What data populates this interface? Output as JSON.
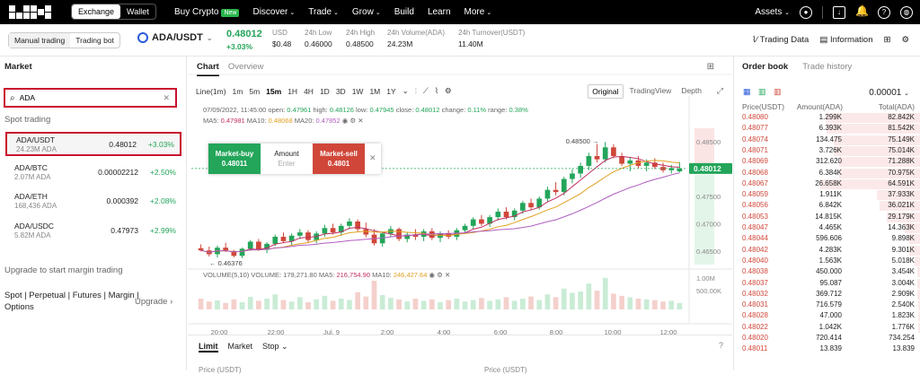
{
  "nav": {
    "exchange": "Exchange",
    "wallet": "Wallet",
    "items": [
      {
        "label": "Buy Crypto",
        "badge": "New"
      },
      {
        "label": "Discover",
        "chev": "⌄"
      },
      {
        "label": "Trade",
        "chev": "⌄"
      },
      {
        "label": "Grow",
        "chev": "⌄"
      },
      {
        "label": "Build",
        "chev": ""
      },
      {
        "label": "Learn",
        "chev": ""
      },
      {
        "label": "More",
        "chev": "⌄"
      }
    ],
    "assets": "Assets"
  },
  "ticker": {
    "mode_manual": "Manual trading",
    "mode_bot": "Trading bot",
    "pair": "ADA/USDT",
    "price": "0.48012",
    "change": "+3.03%",
    "stats": [
      {
        "label": "USD",
        "value": "$0.48"
      },
      {
        "label": "24h Low",
        "value": "0.46000"
      },
      {
        "label": "24h High",
        "value": "0.48500"
      },
      {
        "label": "24h Volume(ADA)",
        "value": "24.23M"
      },
      {
        "label": "24h Turnover(USDT)",
        "value": "11.40M"
      }
    ],
    "trading_data": "Trading Data",
    "information": "Information"
  },
  "market": {
    "title": "Market",
    "search_value": "ADA",
    "section": "Spot trading",
    "rows": [
      {
        "name": "ADA/USDT",
        "sub": "24.23M ADA",
        "price": "0.48012",
        "change": "+3.03%"
      },
      {
        "name": "ADA/BTC",
        "sub": "2.07M ADA",
        "price": "0.00002212",
        "change": "+2.50%"
      },
      {
        "name": "ADA/ETH",
        "sub": "168,436 ADA",
        "price": "0.000392",
        "change": "+2.08%"
      },
      {
        "name": "ADA/USDC",
        "sub": "5.82M ADA",
        "price": "0.47973",
        "change": "+2.99%"
      }
    ],
    "upgrade_text": "Upgrade to start margin trading",
    "types": "Spot | Perpetual | Futures | Margin | Options",
    "upgrade_btn": "Upgrade"
  },
  "chart": {
    "tab_chart": "Chart",
    "tab_overview": "Overview",
    "intervals": [
      "Line(1m)",
      "1m",
      "5m",
      "15m",
      "1H",
      "4H",
      "1D",
      "3D",
      "1W",
      "1M",
      "1Y"
    ],
    "active_interval": "15m",
    "views": [
      "Original",
      "TradingView",
      "Depth"
    ],
    "ohlc_date": "07/09/2022, 11:45:00",
    "ohlc_open": "0.47961",
    "ohlc_high": "0.48126",
    "ohlc_low": "0.47945",
    "ohlc_close": "0.48012",
    "ohlc_change": "0.11%",
    "ohlc_range": "0.38%",
    "ma5": "0.47981",
    "ma10": "0.48068",
    "ma20": "0.47852",
    "high_label": "0.48500",
    "low_label": "0.46376",
    "last_price": "0.48012",
    "y_ticks": [
      "0.48500",
      "0.47500",
      "0.47000",
      "0.46500"
    ],
    "x_ticks": [
      "20:00",
      "22:00",
      "Jul. 9",
      "2:00",
      "4:00",
      "6:00",
      "8:00",
      "10:00",
      "12:00"
    ],
    "vol_label": "VOLUME(5,10)",
    "vol_value": "179,271.80",
    "vol_ma5": "216,754.90",
    "vol_ma10": "246,427.64",
    "vol_ticks": [
      "1.00M",
      "500.00K"
    ],
    "market_buy": "Market-buy",
    "market_buy_price": "0.48011",
    "amount": "Amount",
    "enter": "Enter",
    "market_sell": "Market-sell",
    "market_sell_price": "0.4801"
  },
  "chart_data": {
    "type": "candlestick",
    "ylim": [
      0.4625,
      0.4875
    ],
    "candles": [
      [
        0.4655,
        0.4662,
        0.4649,
        0.4651
      ],
      [
        0.4651,
        0.4658,
        0.464,
        0.4644
      ],
      [
        0.4644,
        0.466,
        0.4638,
        0.4656
      ],
      [
        0.4656,
        0.4665,
        0.4648,
        0.465
      ],
      [
        0.465,
        0.4652,
        0.4638,
        0.4641
      ],
      [
        0.4641,
        0.4656,
        0.4637,
        0.4654
      ],
      [
        0.4654,
        0.467,
        0.465,
        0.4667
      ],
      [
        0.4667,
        0.4672,
        0.465,
        0.4652
      ],
      [
        0.4652,
        0.4666,
        0.4646,
        0.4663
      ],
      [
        0.4663,
        0.468,
        0.4659,
        0.4676
      ],
      [
        0.4676,
        0.4684,
        0.4664,
        0.4668
      ],
      [
        0.4668,
        0.4682,
        0.466,
        0.4678
      ],
      [
        0.4678,
        0.469,
        0.4672,
        0.4684
      ],
      [
        0.4684,
        0.4688,
        0.4666,
        0.467
      ],
      [
        0.467,
        0.4686,
        0.4664,
        0.4682
      ],
      [
        0.4682,
        0.4698,
        0.4676,
        0.4692
      ],
      [
        0.4692,
        0.47,
        0.468,
        0.4684
      ],
      [
        0.4684,
        0.47,
        0.4678,
        0.4696
      ],
      [
        0.4696,
        0.471,
        0.469,
        0.4704
      ],
      [
        0.4704,
        0.4708,
        0.4686,
        0.469
      ],
      [
        0.469,
        0.4702,
        0.4675,
        0.468
      ],
      [
        0.468,
        0.469,
        0.466,
        0.4664
      ],
      [
        0.4664,
        0.4686,
        0.4658,
        0.4682
      ],
      [
        0.4682,
        0.4696,
        0.4676,
        0.469
      ],
      [
        0.469,
        0.4693,
        0.4668,
        0.4672
      ],
      [
        0.4672,
        0.4684,
        0.4666,
        0.468
      ],
      [
        0.468,
        0.469,
        0.467,
        0.4676
      ],
      [
        0.4676,
        0.469,
        0.4668,
        0.4686
      ],
      [
        0.4686,
        0.4692,
        0.467,
        0.4674
      ],
      [
        0.4674,
        0.4686,
        0.4666,
        0.4682
      ],
      [
        0.4682,
        0.4688,
        0.4672,
        0.4676
      ],
      [
        0.4676,
        0.4692,
        0.467,
        0.4688
      ],
      [
        0.4688,
        0.47,
        0.4682,
        0.4696
      ],
      [
        0.4696,
        0.4712,
        0.469,
        0.4708
      ],
      [
        0.4708,
        0.4716,
        0.4696,
        0.47
      ],
      [
        0.47,
        0.4716,
        0.4694,
        0.4712
      ],
      [
        0.4712,
        0.4728,
        0.4706,
        0.4722
      ],
      [
        0.4722,
        0.473,
        0.4708,
        0.4712
      ],
      [
        0.4712,
        0.4728,
        0.4706,
        0.4724
      ],
      [
        0.4724,
        0.4742,
        0.4718,
        0.4738
      ],
      [
        0.4738,
        0.4746,
        0.4726,
        0.473
      ],
      [
        0.473,
        0.475,
        0.4726,
        0.4746
      ],
      [
        0.4746,
        0.4768,
        0.474,
        0.4762
      ],
      [
        0.4762,
        0.4776,
        0.4752,
        0.4758
      ],
      [
        0.4758,
        0.4786,
        0.4752,
        0.4782
      ],
      [
        0.4782,
        0.48,
        0.4774,
        0.4792
      ],
      [
        0.4792,
        0.4812,
        0.4784,
        0.4806
      ],
      [
        0.4806,
        0.483,
        0.4798,
        0.4824
      ],
      [
        0.4824,
        0.4846,
        0.4812,
        0.4818
      ],
      [
        0.4818,
        0.485,
        0.4812,
        0.484
      ],
      [
        0.484,
        0.4846,
        0.482,
        0.4824
      ],
      [
        0.4824,
        0.483,
        0.4806,
        0.481
      ],
      [
        0.481,
        0.4822,
        0.4796,
        0.4816
      ],
      [
        0.4816,
        0.4824,
        0.4802,
        0.4806
      ],
      [
        0.4806,
        0.4818,
        0.4796,
        0.4812
      ],
      [
        0.4812,
        0.482,
        0.48,
        0.4804
      ],
      [
        0.4804,
        0.4812,
        0.4794,
        0.4798
      ],
      [
        0.4798,
        0.4808,
        0.4792,
        0.4802
      ],
      [
        0.4796,
        0.4813,
        0.4794,
        0.4801
      ]
    ],
    "volumes": [
      0.3,
      0.22,
      0.25,
      0.18,
      0.28,
      0.2,
      0.35,
      0.24,
      0.3,
      0.42,
      0.26,
      0.22,
      0.34,
      0.2,
      0.28,
      0.38,
      0.24,
      0.3,
      0.26,
      0.48,
      0.36,
      0.8,
      0.4,
      0.32,
      0.28,
      0.22,
      0.3,
      0.24,
      0.28,
      0.2,
      0.26,
      0.3,
      0.22,
      0.26,
      0.32,
      0.24,
      0.28,
      0.34,
      0.24,
      0.3,
      0.36,
      0.26,
      0.42,
      0.34,
      0.58,
      0.46,
      0.5,
      0.72,
      0.52,
      0.88,
      0.44,
      0.38,
      0.34,
      0.3,
      0.28,
      0.26,
      0.22,
      0.24,
      0.18
    ]
  },
  "order_tabs": [
    "Limit",
    "Market",
    "Stop"
  ],
  "orderbook": {
    "tab_book": "Order book",
    "tab_history": "Trade history",
    "precision": "0.00001",
    "col_price": "Price(USDT)",
    "col_amount": "Amount(ADA)",
    "col_total": "Total(ADA)",
    "rows": [
      {
        "p": "0.48080",
        "a": "1.299K",
        "t": "82.842K",
        "d": 0.76
      },
      {
        "p": "0.48077",
        "a": "6.393K",
        "t": "81.542K",
        "d": 0.75
      },
      {
        "p": "0.48074",
        "a": "134.475",
        "t": "75.149K",
        "d": 0.69
      },
      {
        "p": "0.48071",
        "a": "3.726K",
        "t": "75.014K",
        "d": 0.69
      },
      {
        "p": "0.48069",
        "a": "312.620",
        "t": "71.288K",
        "d": 0.65
      },
      {
        "p": "0.48068",
        "a": "6.384K",
        "t": "70.975K",
        "d": 0.65
      },
      {
        "p": "0.48067",
        "a": "26.658K",
        "t": "64.591K",
        "d": 0.8
      },
      {
        "p": "0.48059",
        "a": "1.911K",
        "t": "37.933K",
        "d": 0.35
      },
      {
        "p": "0.48056",
        "a": "6.842K",
        "t": "36.021K",
        "d": 0.33
      },
      {
        "p": "0.48053",
        "a": "14.815K",
        "t": "29.179K",
        "d": 0.27
      },
      {
        "p": "0.48047",
        "a": "4.465K",
        "t": "14.363K",
        "d": 0.13
      },
      {
        "p": "0.48044",
        "a": "596.606",
        "t": "9.898K",
        "d": 0.09
      },
      {
        "p": "0.48042",
        "a": "4.283K",
        "t": "9.301K",
        "d": 0.09
      },
      {
        "p": "0.48040",
        "a": "1.563K",
        "t": "5.018K",
        "d": 0.05
      },
      {
        "p": "0.48038",
        "a": "450.000",
        "t": "3.454K",
        "d": 0.03
      },
      {
        "p": "0.48037",
        "a": "95.087",
        "t": "3.004K",
        "d": 0.03
      },
      {
        "p": "0.48032",
        "a": "369.712",
        "t": "2.909K",
        "d": 0.03
      },
      {
        "p": "0.48031",
        "a": "716.579",
        "t": "2.540K",
        "d": 0.02
      },
      {
        "p": "0.48028",
        "a": "47.000",
        "t": "1.823K",
        "d": 0.02
      },
      {
        "p": "0.48022",
        "a": "1.042K",
        "t": "1.776K",
        "d": 0.02
      },
      {
        "p": "0.48020",
        "a": "720.414",
        "t": "734.254",
        "d": 0.01
      },
      {
        "p": "0.48011",
        "a": "13.839",
        "t": "13.839",
        "d": 0.01
      }
    ]
  },
  "bottom": {
    "price_label": "Price (USDT)"
  },
  "colors": {
    "up": "#23a55a",
    "down": "#d0473a",
    "highlight": "#c8102e"
  }
}
